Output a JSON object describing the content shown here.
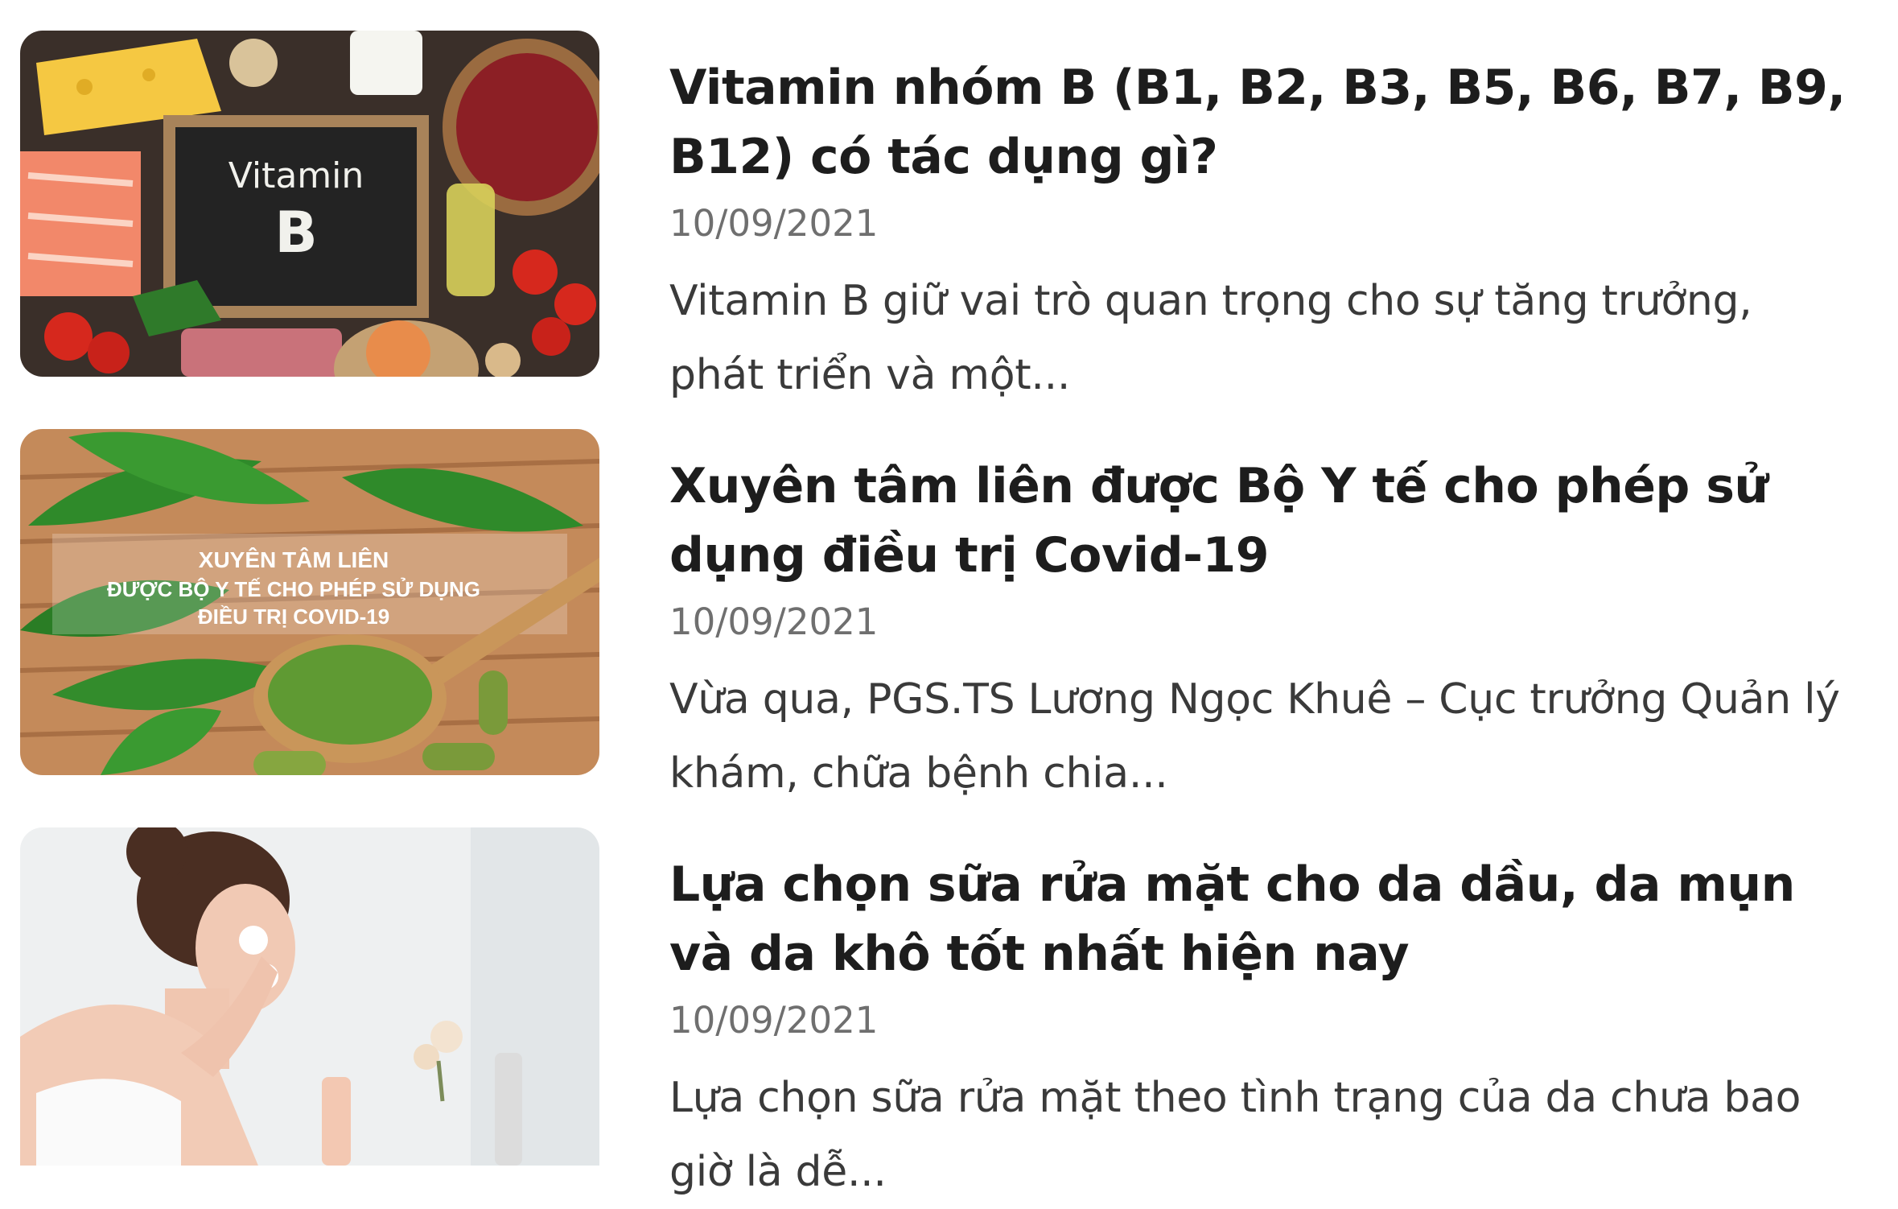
{
  "articles": [
    {
      "title": "Vitamin nhóm B (B1, B2, B3, B5, B6, B7, B9, B12) có tác dụng gì?",
      "date": "10/09/2021",
      "excerpt": "Vitamin B giữ vai trò quan trọng cho sự tăng trưởng, phát triển và một...",
      "image": {
        "board_line1": "Vitamin",
        "board_line2": "B"
      }
    },
    {
      "title": "Xuyên tâm liên được Bộ Y tế cho phép sử dụng điều trị Covid-19",
      "date": "10/09/2021",
      "excerpt": "Vừa qua, PGS.TS Lương Ngọc Khuê – Cục trưởng Quản lý khám, chữa bệnh chia...",
      "image": {
        "banner_line1": "XUYÊN TÂM LIÊN",
        "banner_line2": "ĐƯỢC BỘ Y TẾ CHO PHÉP SỬ DỤNG",
        "banner_line3": "ĐIỀU TRỊ COVID-19"
      }
    },
    {
      "title": "Lựa chọn sữa rửa mặt cho da dầu, da mụn và da khô tốt nhất hiện nay",
      "date": "10/09/2021",
      "excerpt": "Lựa chọn sữa rửa mặt theo tình trạng của da chưa bao giờ là dễ...",
      "image": {}
    }
  ]
}
